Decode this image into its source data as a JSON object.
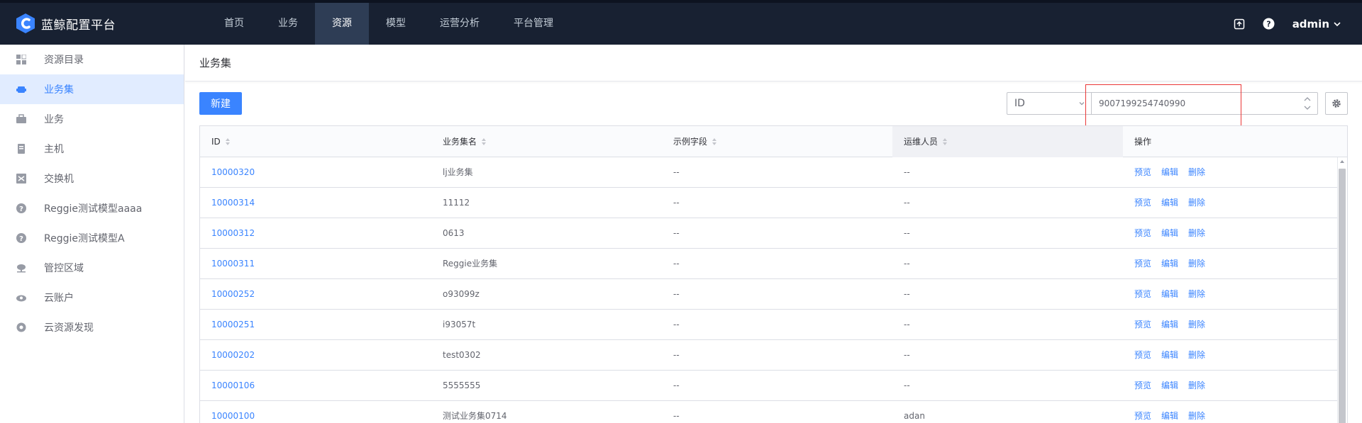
{
  "app": {
    "title": "蓝鲸配置平台"
  },
  "nav": {
    "items": [
      {
        "label": "首页"
      },
      {
        "label": "业务"
      },
      {
        "label": "资源"
      },
      {
        "label": "模型"
      },
      {
        "label": "运营分析"
      },
      {
        "label": "平台管理"
      }
    ],
    "active_index": 2
  },
  "user": {
    "name": "admin"
  },
  "sidebar": {
    "items": [
      {
        "label": "资源目录",
        "icon": "directory-icon"
      },
      {
        "label": "业务集",
        "icon": "business-set-icon"
      },
      {
        "label": "业务",
        "icon": "briefcase-icon"
      },
      {
        "label": "主机",
        "icon": "host-icon"
      },
      {
        "label": "交换机",
        "icon": "switch-icon"
      },
      {
        "label": "Reggie测试模型aaaa",
        "icon": "question-icon"
      },
      {
        "label": "Reggie测试模型A",
        "icon": "question-icon"
      },
      {
        "label": "管控区域",
        "icon": "cloud-area-icon"
      },
      {
        "label": "云账户",
        "icon": "cloud-account-icon"
      },
      {
        "label": "云资源发现",
        "icon": "cloud-discovery-icon"
      }
    ],
    "active_index": 1
  },
  "page": {
    "title": "业务集"
  },
  "toolbar": {
    "new_label": "新建",
    "field_select": "ID",
    "search_value": "9007199254740990"
  },
  "table": {
    "headers": [
      "ID",
      "业务集名",
      "示例字段",
      "运维人员",
      "操作"
    ],
    "op_labels": {
      "preview": "预览",
      "edit": "编辑",
      "delete": "删除"
    },
    "rows": [
      {
        "id": "10000320",
        "name": "lj业务集",
        "sample": "--",
        "maintainer": "--"
      },
      {
        "id": "10000314",
        "name": "11112",
        "sample": "--",
        "maintainer": "--"
      },
      {
        "id": "10000312",
        "name": "0613",
        "sample": "--",
        "maintainer": "--"
      },
      {
        "id": "10000311",
        "name": "Reggie业务集",
        "sample": "--",
        "maintainer": "--"
      },
      {
        "id": "10000252",
        "name": "o93099z",
        "sample": "--",
        "maintainer": "--"
      },
      {
        "id": "10000251",
        "name": "i93057t",
        "sample": "--",
        "maintainer": "--"
      },
      {
        "id": "10000202",
        "name": "test0302",
        "sample": "--",
        "maintainer": "--"
      },
      {
        "id": "10000106",
        "name": "5555555",
        "sample": "--",
        "maintainer": "--"
      },
      {
        "id": "10000100",
        "name": "测试业务集0714",
        "sample": "--",
        "maintainer": "adan"
      }
    ]
  },
  "colors": {
    "topbar": "#182132",
    "accent": "#3a84ff",
    "highlight_box": "#ea3636"
  }
}
